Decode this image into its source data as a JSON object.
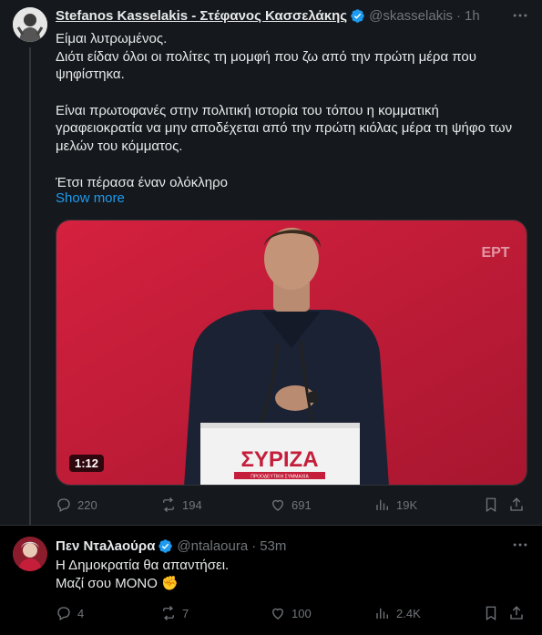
{
  "tweet1": {
    "author_name": "Stefanos Kasselakis - Στέφανος Κασσελάκης",
    "handle": "@skasselakis",
    "separator": "·",
    "time": "1h",
    "lines": [
      "Είμαι λυτρωμένος.",
      "Διότι είδαν όλοι οι πολίτες τη μομφή που ζω από την πρώτη μέρα που",
      "ψηφίστηκα.",
      "",
      "Είναι πρωτοφανές στην πολιτική ιστορία του τόπου η κομματική",
      "γραφειοκρατία να μην αποδέχεται από την πρώτη κιόλας μέρα τη ψήφο των",
      "μελών του κόμματος.",
      "",
      "Έτσι πέρασα έναν ολόκληρο"
    ],
    "show_more": "Show more",
    "video": {
      "duration": "1:12",
      "channel_logo": "ΕΡΤ",
      "podium_logo": "ΣΥΡΙΖΑ",
      "podium_sub": "ΠΡΟΟΔΕΥΤΙΚΗ ΣΥΜΜΑΧΙΑ"
    },
    "stats": {
      "replies": "220",
      "reposts": "194",
      "likes": "691",
      "views": "19K"
    }
  },
  "tweet2": {
    "author_name": "Πεν Ντaλaούρα",
    "handle": "@ntalaoura",
    "separator": "·",
    "time": "53m",
    "line1": "Η Δημοκρατία θα απαντήσει.",
    "line2": "Μαζί σου ΜΟΝΟ",
    "emoji": "✊",
    "stats": {
      "replies": "4",
      "reposts": "7",
      "likes": "100",
      "views": "2.4K"
    }
  },
  "colors": {
    "accent": "#1d9bf0",
    "muted": "#71767b",
    "verified": "#1d9bf0",
    "media_bg": "#c41e3a"
  },
  "icons": [
    "more-icon",
    "verified-badge-icon",
    "reply-icon",
    "repost-icon",
    "like-icon",
    "views-icon",
    "bookmark-icon",
    "share-icon"
  ]
}
